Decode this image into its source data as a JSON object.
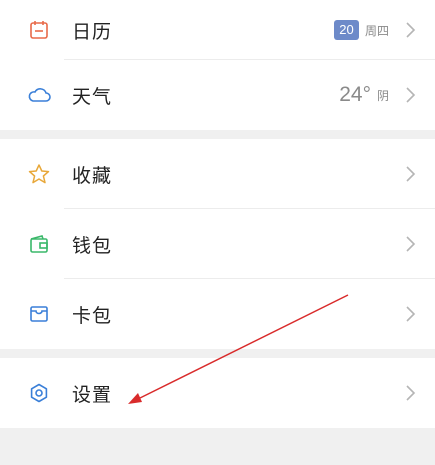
{
  "colors": {
    "calendar_icon": "#e86a4a",
    "weather_icon": "#3a7fd8",
    "favorites_icon": "#e8a83a",
    "wallet_icon": "#3ab86a",
    "card_icon": "#3a7fd8",
    "settings_icon": "#3a7fd8",
    "annotation_arrow": "#d92b2b"
  },
  "group1": {
    "calendar": {
      "label": "日历",
      "icon": "calendar-icon",
      "date": "20",
      "weekday": "周四"
    },
    "weather": {
      "label": "天气",
      "icon": "cloud-icon",
      "temperature": "24°",
      "condition": "阴"
    }
  },
  "group2": {
    "favorites": {
      "label": "收藏",
      "icon": "star-icon"
    },
    "wallet": {
      "label": "钱包",
      "icon": "wallet-icon"
    },
    "card": {
      "label": "卡包",
      "icon": "card-icon"
    }
  },
  "group3": {
    "settings": {
      "label": "设置",
      "icon": "gear-icon"
    }
  }
}
